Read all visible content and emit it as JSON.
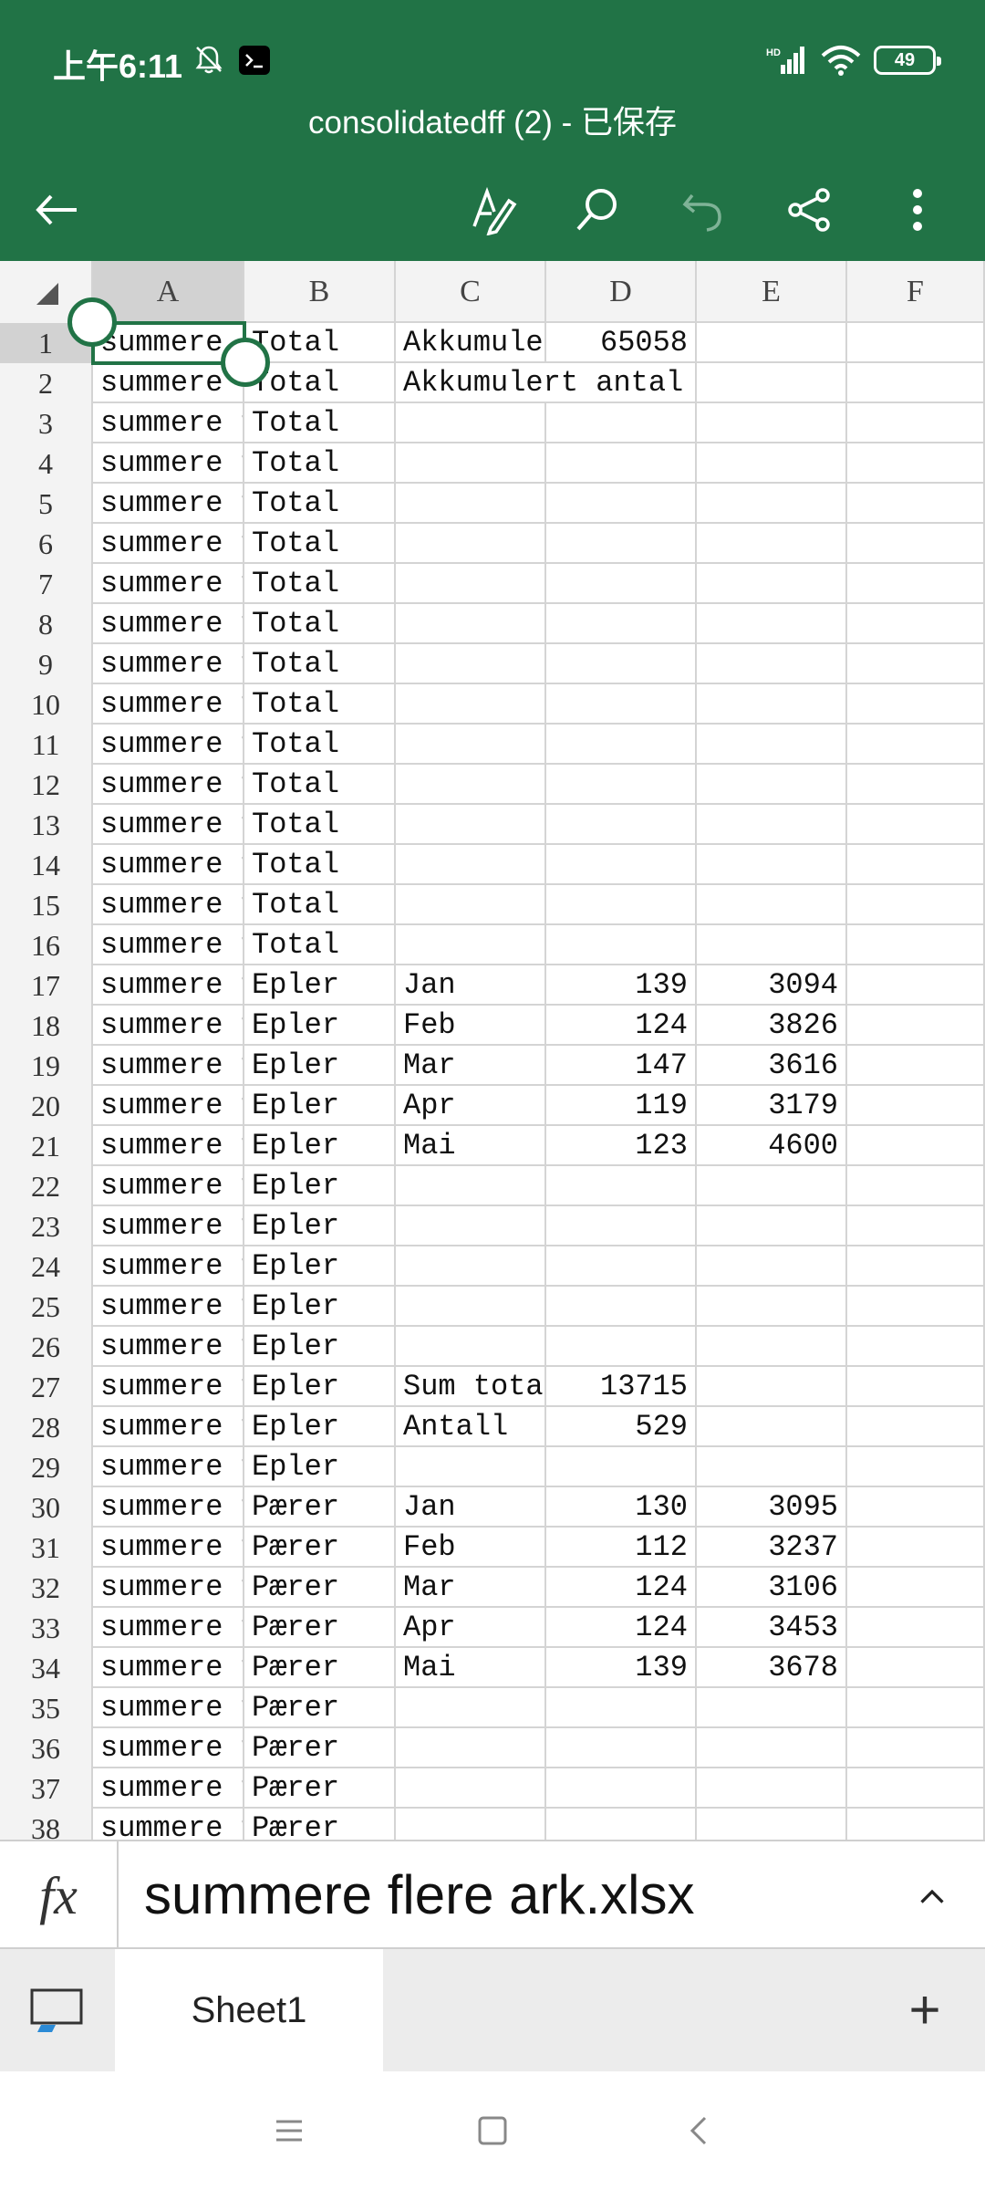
{
  "status_bar": {
    "time": "上午6:11",
    "battery": "49",
    "network_label": "HD"
  },
  "header": {
    "title": "consolidatedff (2) - 已保存"
  },
  "toolbar": {
    "back": "back-arrow",
    "icons": [
      "pen-format-icon",
      "search-icon",
      "undo-icon",
      "share-icon",
      "more-vertical-icon"
    ]
  },
  "grid": {
    "columns": [
      "A",
      "B",
      "C",
      "D",
      "E",
      "F"
    ],
    "selected_cell": "A1",
    "rows": [
      {
        "n": "1",
        "a": "summere",
        "b": "Total",
        "c": "Akkumuler",
        "d": "65058",
        "e": ""
      },
      {
        "n": "2",
        "a": "summere",
        "b": "Total",
        "c": "Akkumulert antal",
        "d": "",
        "e": ""
      },
      {
        "n": "3",
        "a": "summere f",
        "b": "Total",
        "c": "",
        "d": "",
        "e": ""
      },
      {
        "n": "4",
        "a": "summere f",
        "b": "Total",
        "c": "",
        "d": "",
        "e": ""
      },
      {
        "n": "5",
        "a": "summere f",
        "b": "Total",
        "c": "",
        "d": "",
        "e": ""
      },
      {
        "n": "6",
        "a": "summere f",
        "b": "Total",
        "c": "",
        "d": "",
        "e": ""
      },
      {
        "n": "7",
        "a": "summere f",
        "b": "Total",
        "c": "",
        "d": "",
        "e": ""
      },
      {
        "n": "8",
        "a": "summere f",
        "b": "Total",
        "c": "",
        "d": "",
        "e": ""
      },
      {
        "n": "9",
        "a": "summere f",
        "b": "Total",
        "c": "",
        "d": "",
        "e": ""
      },
      {
        "n": "10",
        "a": "summere f",
        "b": "Total",
        "c": "",
        "d": "",
        "e": ""
      },
      {
        "n": "11",
        "a": "summere f",
        "b": "Total",
        "c": "",
        "d": "",
        "e": ""
      },
      {
        "n": "12",
        "a": "summere f",
        "b": "Total",
        "c": "",
        "d": "",
        "e": ""
      },
      {
        "n": "13",
        "a": "summere f",
        "b": "Total",
        "c": "",
        "d": "",
        "e": ""
      },
      {
        "n": "14",
        "a": "summere f",
        "b": "Total",
        "c": "",
        "d": "",
        "e": ""
      },
      {
        "n": "15",
        "a": "summere f",
        "b": "Total",
        "c": "",
        "d": "",
        "e": ""
      },
      {
        "n": "16",
        "a": "summere f",
        "b": "Total",
        "c": "",
        "d": "",
        "e": ""
      },
      {
        "n": "17",
        "a": "summere f",
        "b": "Epler",
        "c": "Jan",
        "d": "139",
        "e": "3094"
      },
      {
        "n": "18",
        "a": "summere f",
        "b": "Epler",
        "c": "Feb",
        "d": "124",
        "e": "3826"
      },
      {
        "n": "19",
        "a": "summere f",
        "b": "Epler",
        "c": "Mar",
        "d": "147",
        "e": "3616"
      },
      {
        "n": "20",
        "a": "summere f",
        "b": "Epler",
        "c": "Apr",
        "d": "119",
        "e": "3179"
      },
      {
        "n": "21",
        "a": "summere f",
        "b": "Epler",
        "c": "Mai",
        "d": "123",
        "e": "4600"
      },
      {
        "n": "22",
        "a": "summere f",
        "b": "Epler",
        "c": "",
        "d": "",
        "e": ""
      },
      {
        "n": "23",
        "a": "summere f",
        "b": "Epler",
        "c": "",
        "d": "",
        "e": ""
      },
      {
        "n": "24",
        "a": "summere f",
        "b": "Epler",
        "c": "",
        "d": "",
        "e": ""
      },
      {
        "n": "25",
        "a": "summere f",
        "b": "Epler",
        "c": "",
        "d": "",
        "e": ""
      },
      {
        "n": "26",
        "a": "summere f",
        "b": "Epler",
        "c": "",
        "d": "",
        "e": ""
      },
      {
        "n": "27",
        "a": "summere f",
        "b": "Epler",
        "c": "Sum total",
        "d": "13715",
        "e": ""
      },
      {
        "n": "28",
        "a": "summere f",
        "b": "Epler",
        "c": "Antall",
        "d": "529",
        "e": ""
      },
      {
        "n": "29",
        "a": "summere f",
        "b": "Epler",
        "c": "",
        "d": "",
        "e": ""
      },
      {
        "n": "30",
        "a": "summere f",
        "b": "Pærer",
        "c": "Jan",
        "d": "130",
        "e": "3095"
      },
      {
        "n": "31",
        "a": "summere f",
        "b": "Pærer",
        "c": "Feb",
        "d": "112",
        "e": "3237"
      },
      {
        "n": "32",
        "a": "summere f",
        "b": "Pærer",
        "c": "Mar",
        "d": "124",
        "e": "3106"
      },
      {
        "n": "33",
        "a": "summere f",
        "b": "Pærer",
        "c": "Apr",
        "d": "124",
        "e": "3453"
      },
      {
        "n": "34",
        "a": "summere f",
        "b": "Pærer",
        "c": "Mai",
        "d": "139",
        "e": "3678"
      },
      {
        "n": "35",
        "a": "summere f",
        "b": "Pærer",
        "c": "",
        "d": "",
        "e": ""
      },
      {
        "n": "36",
        "a": "summere f",
        "b": "Pærer",
        "c": "",
        "d": "",
        "e": ""
      },
      {
        "n": "37",
        "a": "summere f",
        "b": "Pærer",
        "c": "",
        "d": "",
        "e": ""
      },
      {
        "n": "38",
        "a": "summere f",
        "b": "Pærer",
        "c": "",
        "d": "",
        "e": ""
      }
    ]
  },
  "formula_bar": {
    "fx_label": "fx",
    "value": "summere flere ark.xlsx"
  },
  "sheets": {
    "tabs": [
      "Sheet1"
    ],
    "add_label": "+"
  },
  "colors": {
    "accent": "#217346",
    "grid_line": "#d4d4d4",
    "header_bg": "#f3f3f3"
  }
}
